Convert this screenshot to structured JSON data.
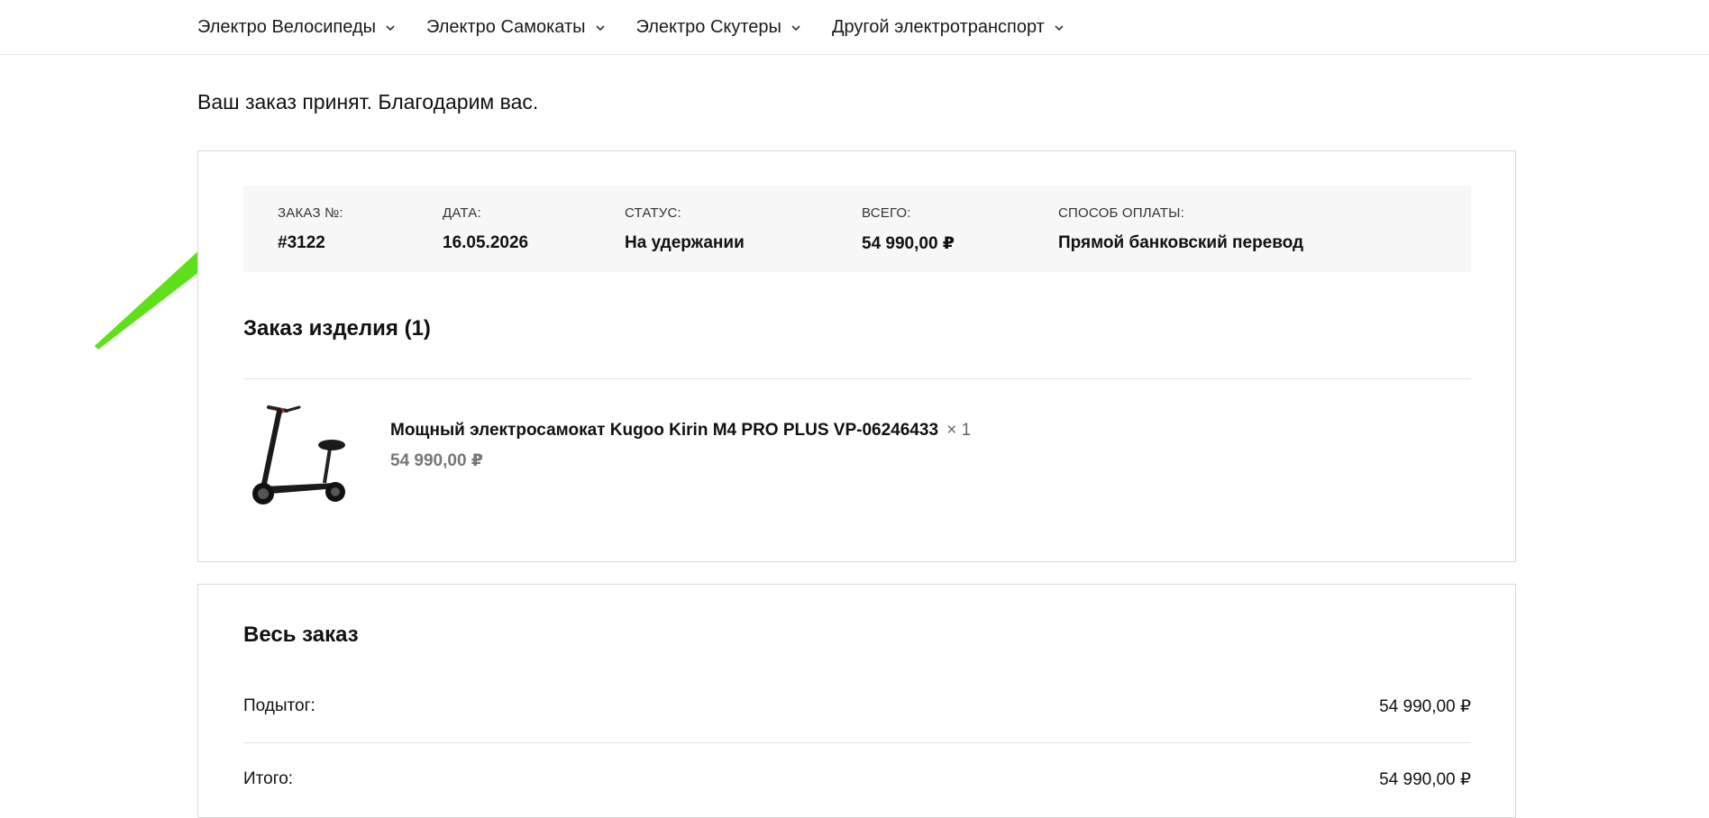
{
  "nav": {
    "items": [
      {
        "label": "Электро Велосипеды"
      },
      {
        "label": "Электро Самокаты"
      },
      {
        "label": "Электро Скутеры"
      },
      {
        "label": "Другой электротранспорт"
      }
    ]
  },
  "notice": "Ваш заказ принят. Благодарим вас.",
  "overview": {
    "order_number_label": "ЗАКАЗ №:",
    "order_number": "#3122",
    "date_label": "ДАТА:",
    "date": "16.05.2026",
    "status_label": "СТАТУС:",
    "status": "На удержании",
    "total_label": "ВСЕГО:",
    "total": "54 990,00 ₽",
    "payment_label": "СПОСОБ ОПЛАТЫ:",
    "payment": "Прямой банковский перевод"
  },
  "items_section": {
    "title": "Заказ изделия (1)",
    "items": [
      {
        "name": "Мощный электросамокат Kugoo Kirin M4 PRO PLUS VP-06246433",
        "qty": "× 1",
        "price": "54 990,00 ₽"
      }
    ]
  },
  "totals_section": {
    "title": "Весь заказ",
    "subtotal_label": "Подытог:",
    "subtotal": "54 990,00 ₽",
    "total_label": "Итого:",
    "total": "54 990,00 ₽"
  },
  "colors": {
    "arrow": "#5ee01a",
    "overview_bg": "#f7f7f7",
    "border": "#d9d9d9"
  }
}
